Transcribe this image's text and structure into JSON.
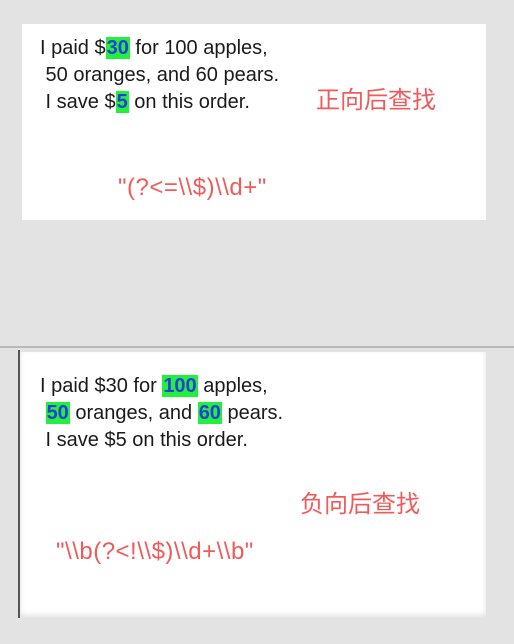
{
  "top": {
    "line1": {
      "pre": "I paid $",
      "hl": "30",
      "post": " for 100 apples,"
    },
    "line2": " 50 oranges, and 60 pears.",
    "line3": {
      "pre": " I save $",
      "hl": "5",
      "post": " on this order."
    },
    "label": "正向后查找",
    "regex": "\"(?<=\\\\$)\\\\d+\""
  },
  "bottom": {
    "line1": {
      "pre": "I paid $30 for ",
      "hl": "100",
      "post": " apples,"
    },
    "line2": {
      "pre": " ",
      "hl1": "50",
      "mid": " oranges, and ",
      "hl2": "60",
      "post": " pears."
    },
    "line3": " I save $5 on this order.",
    "label": "负向后查找",
    "regex": "\"\\\\b(?<!\\\\$)\\\\d+\\\\b\""
  },
  "colors": {
    "highlight_bg": "#22f03c",
    "highlight_fg": "#2a3cdf",
    "label": "#f25a5a"
  }
}
